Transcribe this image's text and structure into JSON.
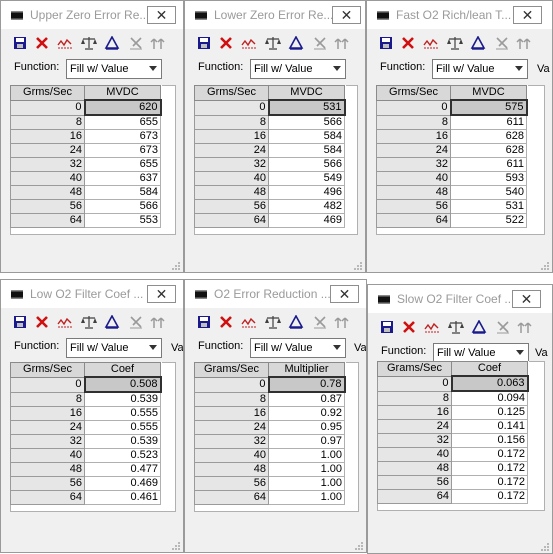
{
  "function_label": "Function:",
  "function_value": "Fill w/ Value",
  "va_label": "Va",
  "close_glyph": "✕",
  "toolbar_icons": [
    "save-icon",
    "delete-icon",
    "graph-icon",
    "scale-icon",
    "triangle-icon",
    "interpolate-icon",
    "smooth-icon"
  ],
  "colors": {
    "save": "#1a1a8c",
    "delete": "#d01010",
    "graph": "#c02020",
    "scale": "#404040"
  },
  "windows": [
    {
      "title": "Upper Zero Error Re...",
      "col1": "Grms/Sec",
      "col2": "MVDC",
      "rows": [
        [
          "0",
          "620"
        ],
        [
          "8",
          "655"
        ],
        [
          "16",
          "673"
        ],
        [
          "24",
          "673"
        ],
        [
          "32",
          "655"
        ],
        [
          "40",
          "637"
        ],
        [
          "48",
          "584"
        ],
        [
          "56",
          "566"
        ],
        [
          "64",
          "553"
        ]
      ]
    },
    {
      "title": "Lower Zero Error Re...",
      "col1": "Grms/Sec",
      "col2": "MVDC",
      "rows": [
        [
          "0",
          "531"
        ],
        [
          "8",
          "566"
        ],
        [
          "16",
          "584"
        ],
        [
          "24",
          "584"
        ],
        [
          "32",
          "566"
        ],
        [
          "40",
          "549"
        ],
        [
          "48",
          "496"
        ],
        [
          "56",
          "482"
        ],
        [
          "64",
          "469"
        ]
      ]
    },
    {
      "title": "Fast O2 Rich/lean T...",
      "col1": "Grms/Sec",
      "col2": "MVDC",
      "rows": [
        [
          "0",
          "575"
        ],
        [
          "8",
          "611"
        ],
        [
          "16",
          "628"
        ],
        [
          "24",
          "628"
        ],
        [
          "32",
          "611"
        ],
        [
          "40",
          "593"
        ],
        [
          "48",
          "540"
        ],
        [
          "56",
          "531"
        ],
        [
          "64",
          "522"
        ]
      ]
    },
    {
      "title": "Low O2 Filter Coef ...",
      "col1": "Grms/Sec",
      "col2": "Coef",
      "rows": [
        [
          "0",
          "0.508"
        ],
        [
          "8",
          "0.539"
        ],
        [
          "16",
          "0.555"
        ],
        [
          "24",
          "0.555"
        ],
        [
          "32",
          "0.539"
        ],
        [
          "40",
          "0.523"
        ],
        [
          "48",
          "0.477"
        ],
        [
          "56",
          "0.469"
        ],
        [
          "64",
          "0.461"
        ]
      ]
    },
    {
      "title": "O2 Error Reduction ...",
      "col1": "Grams/Sec",
      "col2": "Multiplier",
      "rows": [
        [
          "0",
          "0.78"
        ],
        [
          "8",
          "0.87"
        ],
        [
          "16",
          "0.92"
        ],
        [
          "24",
          "0.95"
        ],
        [
          "32",
          "0.97"
        ],
        [
          "40",
          "1.00"
        ],
        [
          "48",
          "1.00"
        ],
        [
          "56",
          "1.00"
        ],
        [
          "64",
          "1.00"
        ]
      ]
    },
    {
      "title": "Slow O2 Filter Coef ...",
      "col1": "Grams/Sec",
      "col2": "Coef",
      "rows": [
        [
          "0",
          "0.063"
        ],
        [
          "8",
          "0.094"
        ],
        [
          "16",
          "0.125"
        ],
        [
          "24",
          "0.141"
        ],
        [
          "32",
          "0.156"
        ],
        [
          "40",
          "0.172"
        ],
        [
          "48",
          "0.172"
        ],
        [
          "56",
          "0.172"
        ],
        [
          "64",
          "0.172"
        ]
      ]
    }
  ]
}
